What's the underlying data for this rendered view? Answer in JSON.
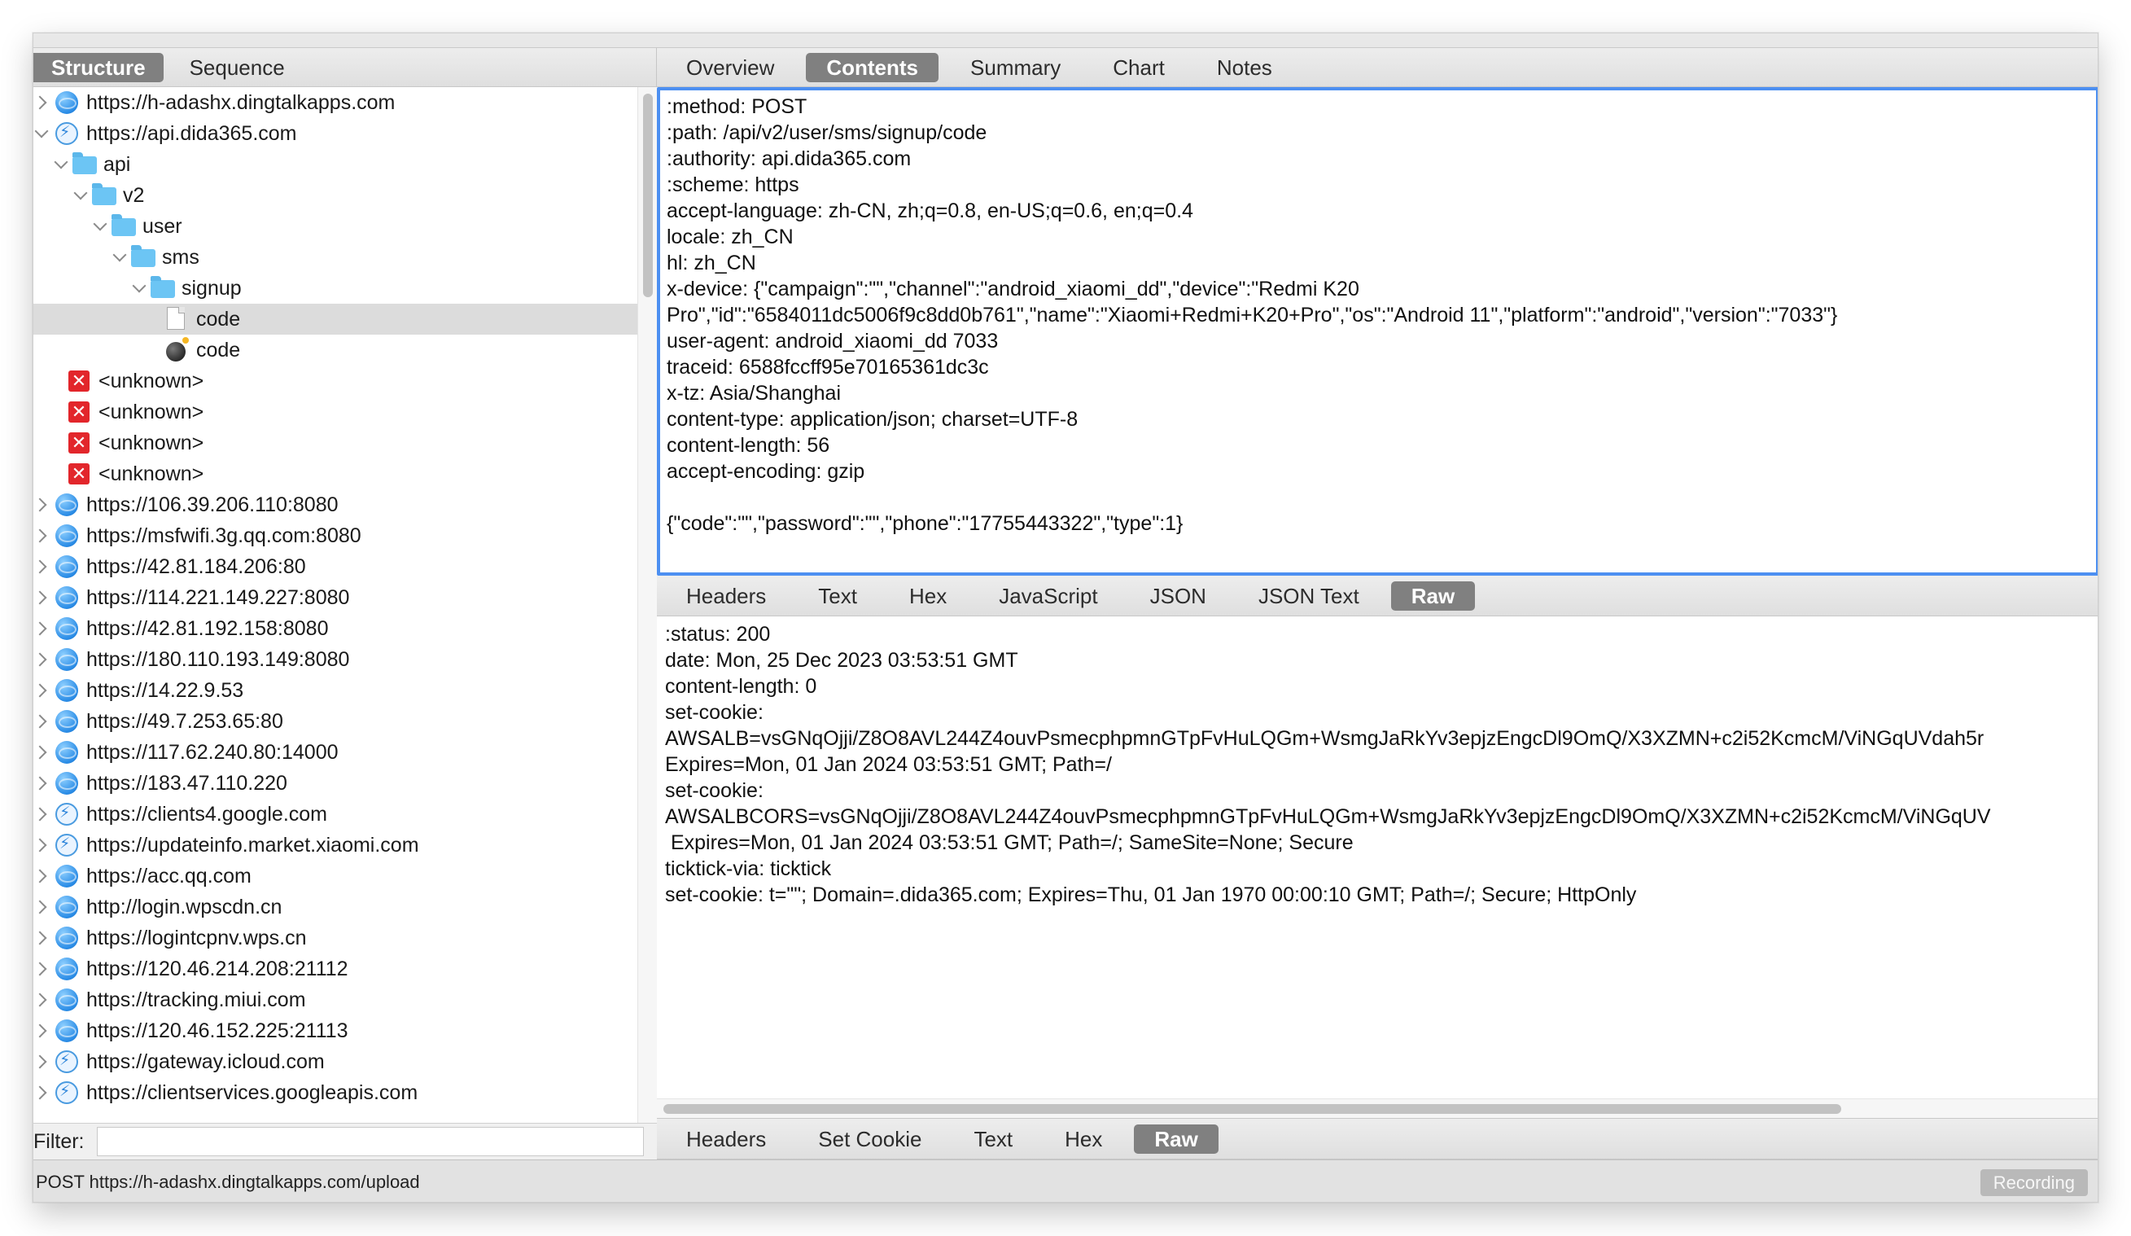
{
  "left_tabs": [
    "Structure",
    "Sequence"
  ],
  "left_tabs_active": 0,
  "tree": [
    {
      "label": "https://h-adashx.dingtalkapps.com",
      "icon": "globe-icon",
      "depth": 0,
      "chevron": "right"
    },
    {
      "label": "https://api.dida365.com",
      "icon": "bolt-icon",
      "depth": 0,
      "chevron": "down"
    },
    {
      "label": "api",
      "icon": "folder-icon",
      "depth": 1,
      "chevron": "down"
    },
    {
      "label": "v2",
      "icon": "folder-icon",
      "depth": 2,
      "chevron": "down"
    },
    {
      "label": "user",
      "icon": "folder-icon",
      "depth": 3,
      "chevron": "down"
    },
    {
      "label": "sms",
      "icon": "folder-icon",
      "depth": 4,
      "chevron": "down"
    },
    {
      "label": "signup",
      "icon": "folder-icon",
      "depth": 5,
      "chevron": "down"
    },
    {
      "label": "code",
      "icon": "file-icon",
      "depth": 6,
      "chevron": "none",
      "selected": true
    },
    {
      "label": "code",
      "icon": "bomb-icon",
      "depth": 6,
      "chevron": "none"
    },
    {
      "label": "<unknown>",
      "icon": "error-icon",
      "depth": 1,
      "chevron": "none"
    },
    {
      "label": "<unknown>",
      "icon": "error-icon",
      "depth": 1,
      "chevron": "none"
    },
    {
      "label": "<unknown>",
      "icon": "error-icon",
      "depth": 1,
      "chevron": "none"
    },
    {
      "label": "<unknown>",
      "icon": "error-icon",
      "depth": 1,
      "chevron": "none"
    },
    {
      "label": "https://106.39.206.110:8080",
      "icon": "globe-icon",
      "depth": 0,
      "chevron": "right"
    },
    {
      "label": "https://msfwifi.3g.qq.com:8080",
      "icon": "globe-icon",
      "depth": 0,
      "chevron": "right"
    },
    {
      "label": "https://42.81.184.206:80",
      "icon": "globe-icon",
      "depth": 0,
      "chevron": "right"
    },
    {
      "label": "https://114.221.149.227:8080",
      "icon": "globe-icon",
      "depth": 0,
      "chevron": "right"
    },
    {
      "label": "https://42.81.192.158:8080",
      "icon": "globe-icon",
      "depth": 0,
      "chevron": "right"
    },
    {
      "label": "https://180.110.193.149:8080",
      "icon": "globe-icon",
      "depth": 0,
      "chevron": "right"
    },
    {
      "label": "https://14.22.9.53",
      "icon": "globe-icon",
      "depth": 0,
      "chevron": "right"
    },
    {
      "label": "https://49.7.253.65:80",
      "icon": "globe-icon",
      "depth": 0,
      "chevron": "right"
    },
    {
      "label": "https://117.62.240.80:14000",
      "icon": "globe-icon",
      "depth": 0,
      "chevron": "right"
    },
    {
      "label": "https://183.47.110.220",
      "icon": "globe-icon",
      "depth": 0,
      "chevron": "right"
    },
    {
      "label": "https://clients4.google.com",
      "icon": "bolt-icon",
      "depth": 0,
      "chevron": "right"
    },
    {
      "label": "https://updateinfo.market.xiaomi.com",
      "icon": "bolt-icon",
      "depth": 0,
      "chevron": "right"
    },
    {
      "label": "https://acc.qq.com",
      "icon": "globe-icon",
      "depth": 0,
      "chevron": "right"
    },
    {
      "label": "http://login.wpscdn.cn",
      "icon": "globe-icon",
      "depth": 0,
      "chevron": "right"
    },
    {
      "label": "https://logintcpnv.wps.cn",
      "icon": "globe-icon",
      "depth": 0,
      "chevron": "right"
    },
    {
      "label": "https://120.46.214.208:21112",
      "icon": "globe-icon",
      "depth": 0,
      "chevron": "right"
    },
    {
      "label": "https://tracking.miui.com",
      "icon": "globe-icon",
      "depth": 0,
      "chevron": "right"
    },
    {
      "label": "https://120.46.152.225:21113",
      "icon": "globe-icon",
      "depth": 0,
      "chevron": "right"
    },
    {
      "label": "https://gateway.icloud.com",
      "icon": "bolt-icon",
      "depth": 0,
      "chevron": "right"
    },
    {
      "label": "https://clientservices.googleapis.com",
      "icon": "bolt-icon",
      "depth": 0,
      "chevron": "right"
    }
  ],
  "filter": {
    "label": "Filter:",
    "value": ""
  },
  "top_tabs": [
    "Overview",
    "Contents",
    "Summary",
    "Chart",
    "Notes"
  ],
  "top_tabs_active": 1,
  "request_lines": [
    ":method: POST",
    ":path: /api/v2/user/sms/signup/code",
    ":authority: api.dida365.com",
    ":scheme: https",
    "accept-language: zh-CN, zh;q=0.8, en-US;q=0.6, en;q=0.4",
    "locale: zh_CN",
    "hl: zh_CN",
    "x-device: {\"campaign\":\"\",\"channel\":\"android_xiaomi_dd\",\"device\":\"Redmi K20",
    "Pro\",\"id\":\"6584011dc5006f9c8dd0b761\",\"name\":\"Xiaomi+Redmi+K20+Pro\",\"os\":\"Android 11\",\"platform\":\"android\",\"version\":\"7033\"}",
    "user-agent: android_xiaomi_dd 7033",
    "traceid: 6588fccff95e70165361dc3c",
    "x-tz: Asia/Shanghai",
    "content-type: application/json; charset=UTF-8",
    "content-length: 56",
    "accept-encoding: gzip",
    "",
    "{\"code\":\"\",\"password\":\"\",\"phone\":\"17755443322\",\"type\":1}"
  ],
  "request_tabs": [
    "Headers",
    "Text",
    "Hex",
    "JavaScript",
    "JSON",
    "JSON Text",
    "Raw"
  ],
  "request_tabs_active": 6,
  "response_lines": [
    ":status: 200",
    "date: Mon, 25 Dec 2023 03:53:51 GMT",
    "content-length: 0",
    "set-cookie:",
    "AWSALB=vsGNqOjji/Z8O8AVL244Z4ouvPsmecphpmnGTpFvHuLQGm+WsmgJaRkYv3epjzEngcDl9OmQ/X3XZMN+c2i52KcmcM/ViNGqUVdah5r",
    "Expires=Mon, 01 Jan 2024 03:53:51 GMT; Path=/",
    "set-cookie:",
    "AWSALBCORS=vsGNqOjji/Z8O8AVL244Z4ouvPsmecphpmnGTpFvHuLQGm+WsmgJaRkYv3epjzEngcDl9OmQ/X3XZMN+c2i52KcmcM/ViNGqUV",
    " Expires=Mon, 01 Jan 2024 03:53:51 GMT; Path=/; SameSite=None; Secure",
    "ticktick-via: ticktick",
    "set-cookie: t=\"\"; Domain=.dida365.com; Expires=Thu, 01 Jan 1970 00:00:10 GMT; Path=/; Secure; HttpOnly"
  ],
  "response_tabs": [
    "Headers",
    "Set Cookie",
    "Text",
    "Hex",
    "Raw"
  ],
  "response_tabs_active": 4,
  "status_bar": {
    "text": "POST https://h-adashx.dingtalkapps.com/upload",
    "recording_label": "Recording"
  },
  "colors": {
    "accent_blue": "#4c8ff1",
    "active_tab": "#808080",
    "error_red": "#e2262b",
    "folder_blue": "#6cc5f4"
  }
}
